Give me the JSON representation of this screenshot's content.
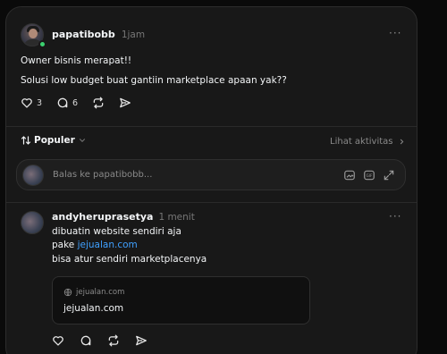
{
  "post": {
    "username": "papatibobb",
    "time": "1jam",
    "line1": "Owner bisnis merapat!!",
    "line2": "Solusi low budget buat gantiin marketplace apaan yak??",
    "likes": "3",
    "comments": "6"
  },
  "sort": {
    "label": "Populer",
    "activity_label": "Lihat aktivitas"
  },
  "reply_box": {
    "placeholder": "Balas ke papatibobb..."
  },
  "reply": {
    "username": "andyheruprasetya",
    "time": "1 menit",
    "line1": "dibuatin website sendiri aja",
    "line2_prefix": "pake ",
    "line2_link": "jejualan.com",
    "line3": "bisa atur sendiri marketplacenya",
    "preview_domain": "jejualan.com",
    "preview_title": "jejualan.com"
  },
  "colors": {
    "background": "#0a0a0a",
    "card": "#181818",
    "online": "#3bd16f",
    "link": "#3fa0ff"
  },
  "icons": {
    "like": "heart-icon",
    "comment": "comment-icon",
    "repost": "repost-icon",
    "share": "send-icon",
    "sort": "sort-arrows-icon",
    "gif": "gif-icon",
    "image": "image-icon",
    "expand": "expand-icon",
    "globe": "globe-icon"
  }
}
